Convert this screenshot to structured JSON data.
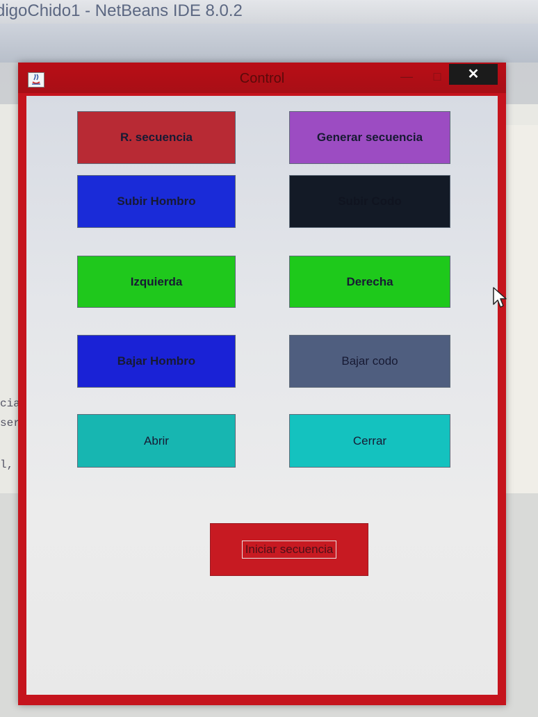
{
  "ide": {
    "title": "digoChido1 - NetBeans IDE 8.0.2",
    "code_fragments": [
      "cia",
      "ser",
      "l,"
    ]
  },
  "window": {
    "title": "Control",
    "minimize_label": "—",
    "maximize_label": "□",
    "close_label": "✕"
  },
  "buttons": {
    "r_secuencia": "R. secuencia",
    "generar_secuencia": "Generar secuencia",
    "subir_hombro": "Subir Hombro",
    "subir_codo": "Subir Codo",
    "izquierda": "Izquierda",
    "derecha": "Derecha",
    "bajar_hombro": "Bajar Hombro",
    "bajar_codo": "Bajar codo",
    "abrir": "Abrir",
    "cerrar": "Cerrar",
    "iniciar_secuencia": "Iniciar secuencia"
  },
  "colors": {
    "window_frame": "#c5141d",
    "r_secuencia": "#b82a34",
    "generar_secuencia": "#9c4cc2",
    "subir_hombro": "#1a2bd8",
    "subir_codo": "#131a26",
    "izquierda": "#1fc81c",
    "derecha": "#1ec91b",
    "bajar_hombro": "#1a22d6",
    "bajar_codo": "#4f5e7f",
    "abrir": "#17b6b1",
    "cerrar": "#14c2bf",
    "iniciar_secuencia": "#c71a22"
  },
  "icons": {
    "window_icon": "java-icon",
    "pointer": "mouse-cursor-icon"
  }
}
